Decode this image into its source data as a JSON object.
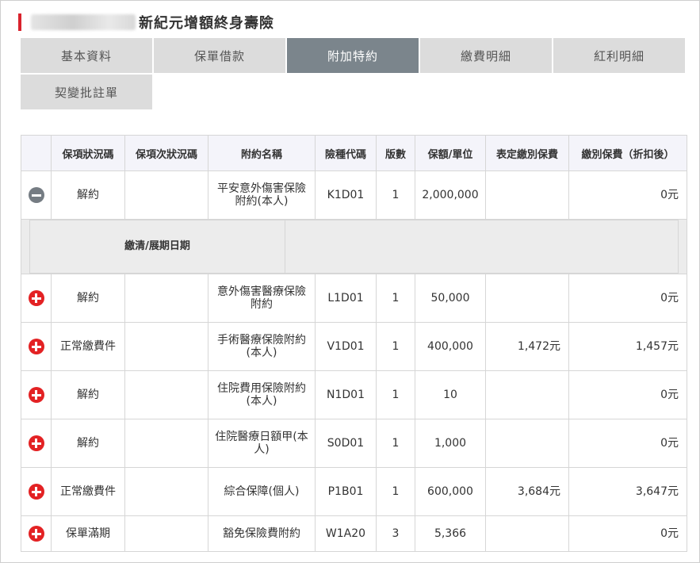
{
  "header": {
    "title": "新紀元增額終身壽險"
  },
  "tabs": [
    {
      "label": "基本資料",
      "active": false
    },
    {
      "label": "保單借款",
      "active": false
    },
    {
      "label": "附加特約",
      "active": true
    },
    {
      "label": "繳費明細",
      "active": false
    },
    {
      "label": "紅利明細",
      "active": false
    },
    {
      "label": "契變批註單",
      "active": false
    }
  ],
  "table": {
    "headers": [
      "",
      "保項狀況碼",
      "保項次狀況碼",
      "附約名稱",
      "險種代碼",
      "版數",
      "保額/單位",
      "表定繳別保費",
      "繳別保費（折扣後）"
    ],
    "detail": {
      "label": "繳清/展期日期",
      "value": ""
    },
    "rows": [
      {
        "icon": "collapse",
        "status": "解約",
        "sub_status": "",
        "name": "平安意外傷害保險附約(本人)",
        "code": "K1D01",
        "version": "1",
        "amount": "2,000,000",
        "list_premium": "",
        "premium": "0元"
      },
      {
        "icon": "expand",
        "status": "解約",
        "sub_status": "",
        "name": "意外傷害醫療保險附約",
        "code": "L1D01",
        "version": "1",
        "amount": "50,000",
        "list_premium": "",
        "premium": "0元"
      },
      {
        "icon": "expand",
        "status": "正常繳費件",
        "sub_status": "",
        "name": "手術醫療保險附約(本人)",
        "code": "V1D01",
        "version": "1",
        "amount": "400,000",
        "list_premium": "1,472元",
        "premium": "1,457元"
      },
      {
        "icon": "expand",
        "status": "解約",
        "sub_status": "",
        "name": "住院費用保險附約(本人)",
        "code": "N1D01",
        "version": "1",
        "amount": "10",
        "list_premium": "",
        "premium": "0元"
      },
      {
        "icon": "expand",
        "status": "解約",
        "sub_status": "",
        "name": "住院醫療日額甲(本人)",
        "code": "S0D01",
        "version": "1",
        "amount": "1,000",
        "list_premium": "",
        "premium": "0元"
      },
      {
        "icon": "expand",
        "status": "正常繳費件",
        "sub_status": "",
        "name": "綜合保障(個人)",
        "code": "P1B01",
        "version": "1",
        "amount": "600,000",
        "list_premium": "3,684元",
        "premium": "3,647元"
      },
      {
        "icon": "expand",
        "status": "保單滿期",
        "sub_status": "",
        "name": "豁免保險費附約",
        "code": "W1A20",
        "version": "3",
        "amount": "5,366",
        "list_premium": "",
        "premium": "0元"
      }
    ]
  }
}
